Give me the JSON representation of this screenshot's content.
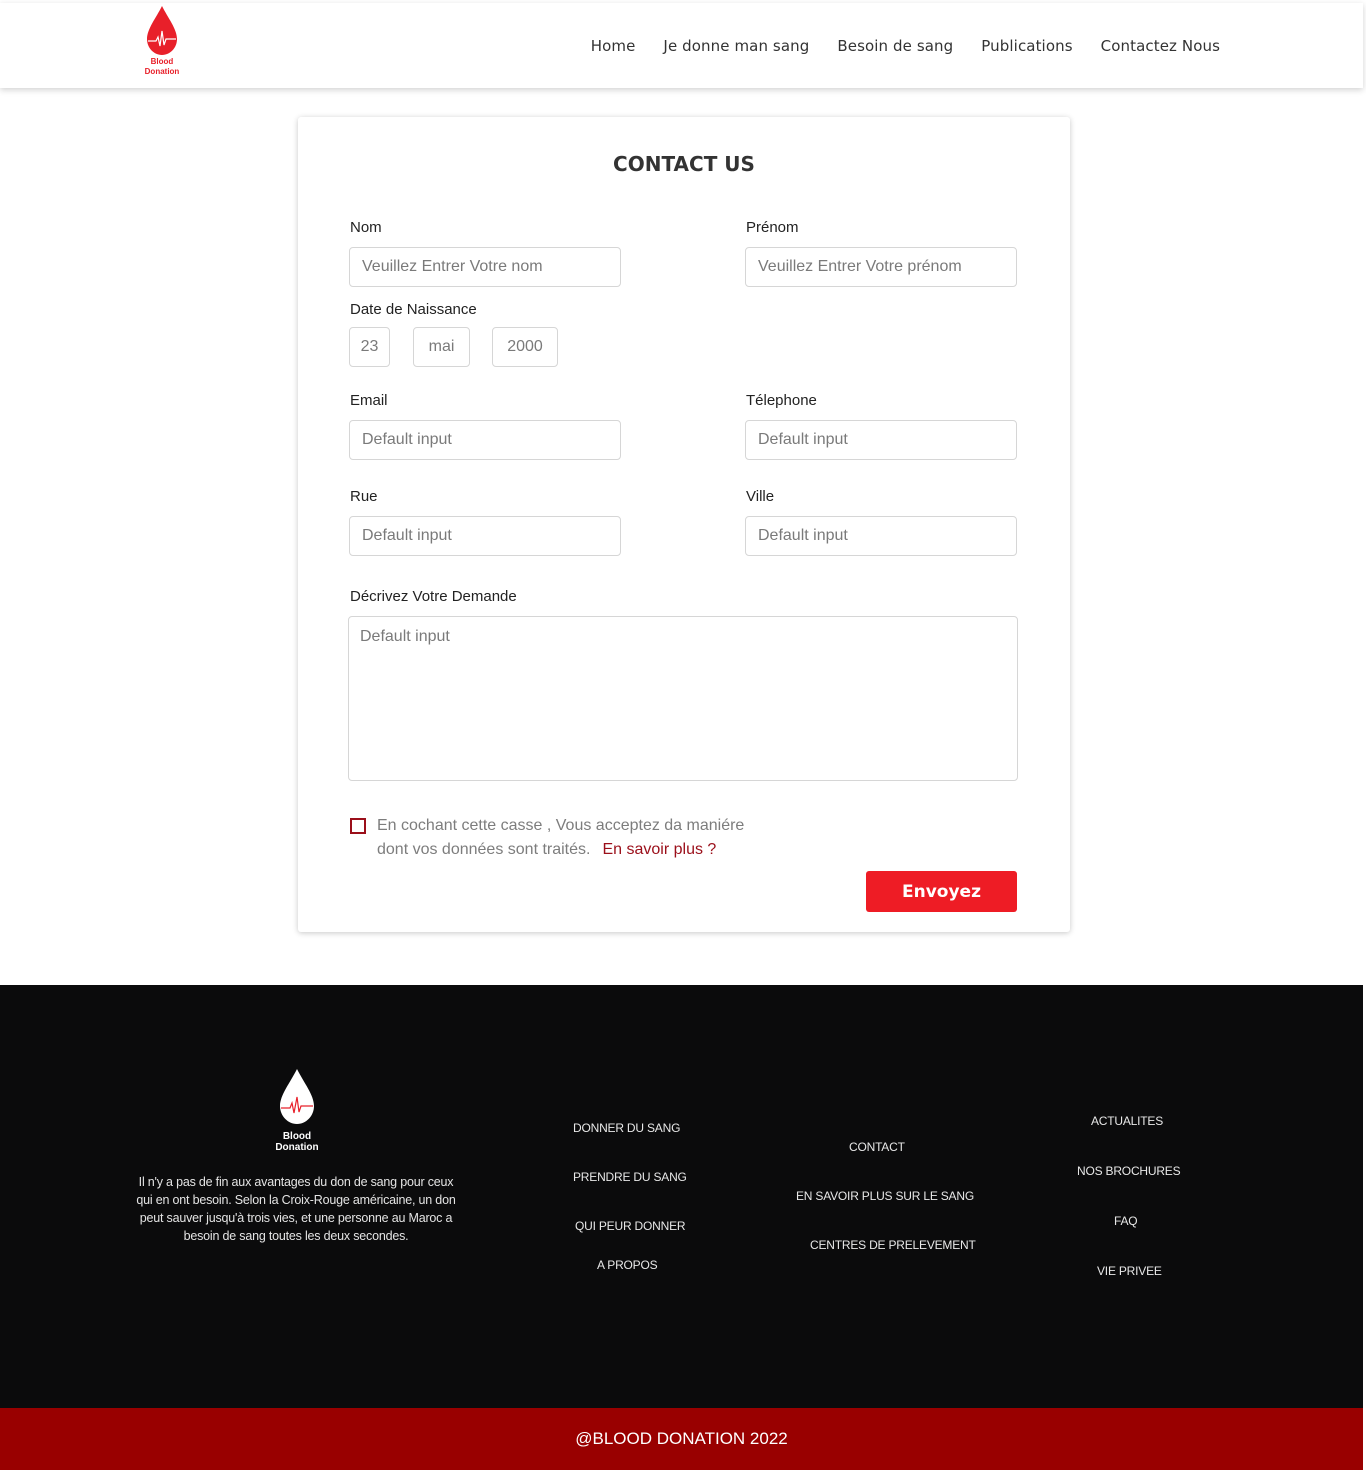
{
  "header": {
    "logo_text": "Blood\nDonation",
    "nav": [
      "Home",
      "Je donne man sang",
      "Besoin de sang",
      "Publications",
      "Contactez Nous"
    ]
  },
  "form": {
    "title": "CONTACT US",
    "nom": {
      "label": "Nom",
      "placeholder": "Veuillez Entrer Votre nom"
    },
    "prenom": {
      "label": "Prénom",
      "placeholder": "Veuillez Entrer Votre prénom"
    },
    "birth": {
      "label": "Date de Naissance",
      "day": "23",
      "month": "mai",
      "year": "2000"
    },
    "email": {
      "label": "Email",
      "placeholder": "Default input"
    },
    "telephone": {
      "label": "Télephone",
      "placeholder": "Default input"
    },
    "rue": {
      "label": "Rue",
      "placeholder": "Default input"
    },
    "ville": {
      "label": "Ville",
      "placeholder": "Default input"
    },
    "demande": {
      "label": "Décrivez Votre Demande",
      "placeholder": "Default input"
    },
    "consent_text": "En cochant cette casse , Vous acceptez da maniére dont vos données sont traités.",
    "consent_link": "En savoir plus ?",
    "submit_label": "Envoyez"
  },
  "footer": {
    "logo_text": "Blood\nDonation",
    "description": "Il n'y a pas de fin aux avantages du don de sang pour ceux qui en ont besoin. Selon la Croix-Rouge américaine, un don peut sauver jusqu'à trois vies, et une personne au Maroc a besoin de sang toutes les deux secondes.",
    "col1": [
      "DONNER DU SANG",
      "PRENDRE DU SANG",
      "QUI PEUR DONNER",
      "A PROPOS"
    ],
    "col2": [
      "CONTACT",
      "EN SAVOIR PLUS SUR LE SANG",
      "CENTRES DE PRELEVEMENT"
    ],
    "col3": [
      "ACTUALITES",
      "NOS BROCHURES",
      "FAQ",
      "VIE PRIVEE"
    ],
    "copyright": "@BLOOD DONATION 2022"
  },
  "colors": {
    "accent": "#ee1c25",
    "dark_red": "#990000",
    "footer_bg": "#0b0b0c"
  }
}
